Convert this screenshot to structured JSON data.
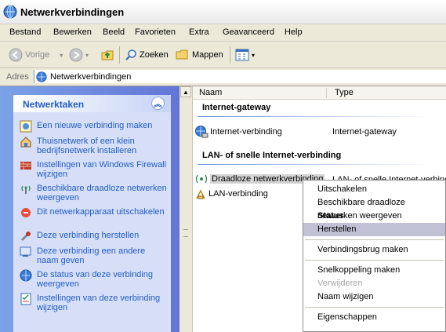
{
  "window": {
    "title": "Netwerkverbindingen"
  },
  "menubar": [
    "Bestand",
    "Bewerken",
    "Beeld",
    "Favorieten",
    "Extra",
    "Geavanceerd",
    "Help"
  ],
  "toolbar": {
    "back_label": "Vorige",
    "search_label": "Zoeken",
    "folders_label": "Mappen"
  },
  "address": {
    "label": "Adres",
    "value": "Netwerkverbindingen"
  },
  "taskpane": {
    "header": "Netwerktaken",
    "tasks": [
      {
        "label": "Een nieuwe verbinding maken",
        "icon": "new-connection-icon"
      },
      {
        "label": "Thuisnetwerk of een klein bedrijfsnetwerk installeren",
        "icon": "home-network-icon"
      },
      {
        "label": "Instellingen van Windows Firewall wijzigen",
        "icon": "firewall-icon"
      },
      {
        "label": "Beschikbare draadloze netwerken weergeven",
        "icon": "wireless-icon"
      },
      {
        "label": "Dit netwerkapparaat uitschakelen",
        "icon": "disable-device-icon"
      },
      {
        "label": "Deze verbinding herstellen",
        "icon": "repair-icon"
      },
      {
        "label": "Deze verbinding een andere naam geven",
        "icon": "rename-icon"
      },
      {
        "label": "De status van deze verbinding weergeven",
        "icon": "status-icon"
      },
      {
        "label": "Instellingen van deze verbinding wijzigen",
        "icon": "properties-icon"
      }
    ]
  },
  "listview": {
    "columns": [
      "Naam",
      "Type"
    ],
    "groups": [
      {
        "title": "Internet-gateway",
        "items": [
          {
            "name": "Internet-verbinding",
            "type": "Internet-gateway"
          }
        ]
      },
      {
        "title": "LAN- of snelle Internet-verbinding",
        "items": [
          {
            "name": "Draadloze netwerkverbinding",
            "type": "LAN- of snelle Internet-verbinding"
          },
          {
            "name": "LAN-verbinding",
            "type": ""
          }
        ]
      }
    ]
  },
  "context_menu": {
    "items": [
      {
        "label": "Uitschakelen",
        "state": "normal"
      },
      {
        "label": "Beschikbare draadloze netwerken weergeven",
        "state": "normal"
      },
      {
        "label": "Status",
        "state": "bold"
      },
      {
        "label": "Herstellen",
        "state": "highlighted"
      },
      {
        "label": "Verbindingsbrug maken",
        "state": "normal"
      },
      {
        "label": "Snelkoppeling maken",
        "state": "normal"
      },
      {
        "label": "Verwijderen",
        "state": "disabled"
      },
      {
        "label": "Naam wijzigen",
        "state": "normal"
      },
      {
        "label": "Eigenschappen",
        "state": "normal"
      }
    ]
  },
  "colors": {
    "task_link": "#215dc6",
    "taskpane_bg": "#6375d6",
    "menu_highlight": "#c1c1d6",
    "selection": "#d4d4d4"
  }
}
